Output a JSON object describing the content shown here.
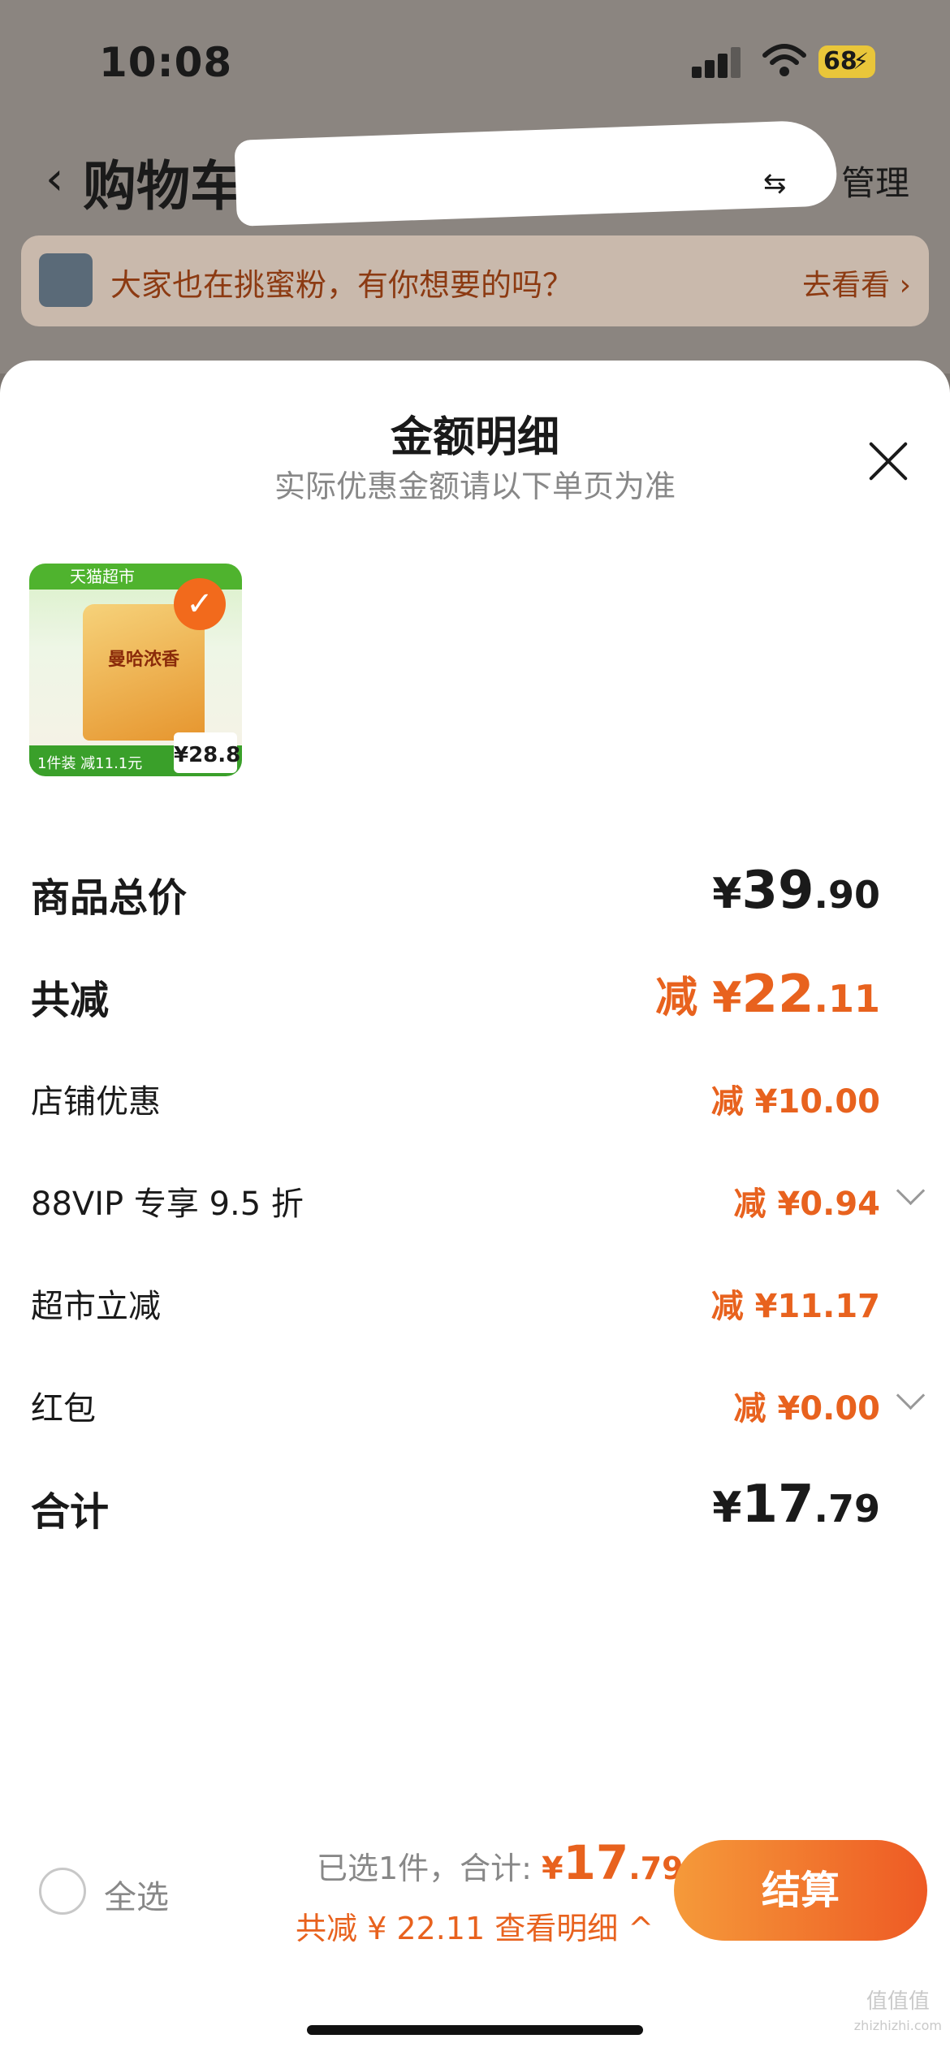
{
  "status_bar": {
    "time": "10:08",
    "battery": "68"
  },
  "background": {
    "nav_title": "购物车",
    "nav_manage": "管理",
    "promo_text": "大家也在挑蜜粉，有你想要的吗？",
    "promo_link": "去看看 ›"
  },
  "sheet": {
    "title": "金额明细",
    "subtitle": "实际优惠金额请以下单页为准",
    "product": {
      "store_label": "天猫超市",
      "bag_label": "曼哈浓香",
      "deal_text": "1件装 减11.1元",
      "price_tag": "¥28.8"
    },
    "rows": [
      {
        "label": "商品总价",
        "prefix": "",
        "symbol": "¥",
        "int": "39",
        "dec": ".90"
      },
      {
        "label": "共减",
        "prefix": "减 ",
        "symbol": "¥",
        "int": "22",
        "dec": ".11"
      },
      {
        "label": "店铺优惠",
        "value": "减 ¥10.00"
      },
      {
        "label": "88VIP 专享 9.5 折",
        "value": "减 ¥0.94"
      },
      {
        "label": "超市立减",
        "value": "减 ¥11.17"
      },
      {
        "label": "红包",
        "value": "减 ¥0.00"
      },
      {
        "label": "合计",
        "prefix": "",
        "symbol": "¥",
        "int": "17",
        "dec": ".79"
      }
    ]
  },
  "bottom_bar": {
    "select_all": "全选",
    "selected_text": "已选1件，合计: ",
    "total_symbol": "¥",
    "total_int": "17",
    "total_dec": ".79",
    "saving_text": "共减 ¥ 22.11  查看明细 ^",
    "checkout_label": "结算"
  },
  "watermark": {
    "logo": "值值值",
    "site": "zhizhizhi.com"
  },
  "colors": {
    "accent": "#e8621e",
    "checkout_start": "#f59a3a",
    "checkout_end": "#ee5a24"
  }
}
